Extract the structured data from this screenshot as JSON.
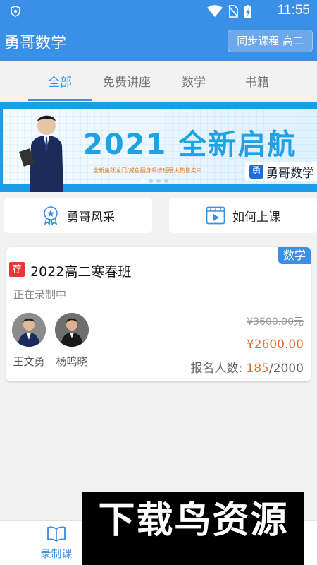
{
  "status_bar": {
    "time": "11:55",
    "icons": [
      "shield-icon",
      "wifi-icon",
      "sim-off-icon",
      "battery-charging-icon"
    ]
  },
  "app_bar": {
    "title": "勇哥数学",
    "sync_button_label": "同步课程 高二"
  },
  "tabs": [
    {
      "label": "全部",
      "active": true
    },
    {
      "label": "免费讲座",
      "active": false
    },
    {
      "label": "数学",
      "active": false
    },
    {
      "label": "书籍",
      "active": false
    }
  ],
  "banner": {
    "headline": "2021 全新启航",
    "subline": "全新鱼跃龙门/咸鱼翻身系统班硬火热售卖中",
    "brand_mark": "勇",
    "brand_text": "勇哥数学",
    "dots": 4,
    "active_dot": 0
  },
  "quick_actions": [
    {
      "label": "勇哥风采",
      "icon": "medal-icon"
    },
    {
      "label": "如何上课",
      "icon": "video-play-icon"
    }
  ],
  "course_card": {
    "subject_tag": "数学",
    "recommend_badge": "荐",
    "title": "2022高二寒春班",
    "status": "正在录制中",
    "teachers": [
      {
        "name": "王文勇"
      },
      {
        "name": "杨鸣晓"
      }
    ],
    "original_price": "¥3600.00元",
    "price": "¥2600.00",
    "enroll_label": "报名人数:",
    "enroll_current": "185",
    "enroll_total": "/2000"
  },
  "bottom_nav": {
    "items": [
      {
        "label": "录制课",
        "icon": "book-open-icon",
        "active": true
      }
    ]
  },
  "watermark": "下载鸟资源",
  "colors": {
    "primary": "#3a8fe6",
    "price": "#e86a2c",
    "recommend": "#e53935"
  }
}
